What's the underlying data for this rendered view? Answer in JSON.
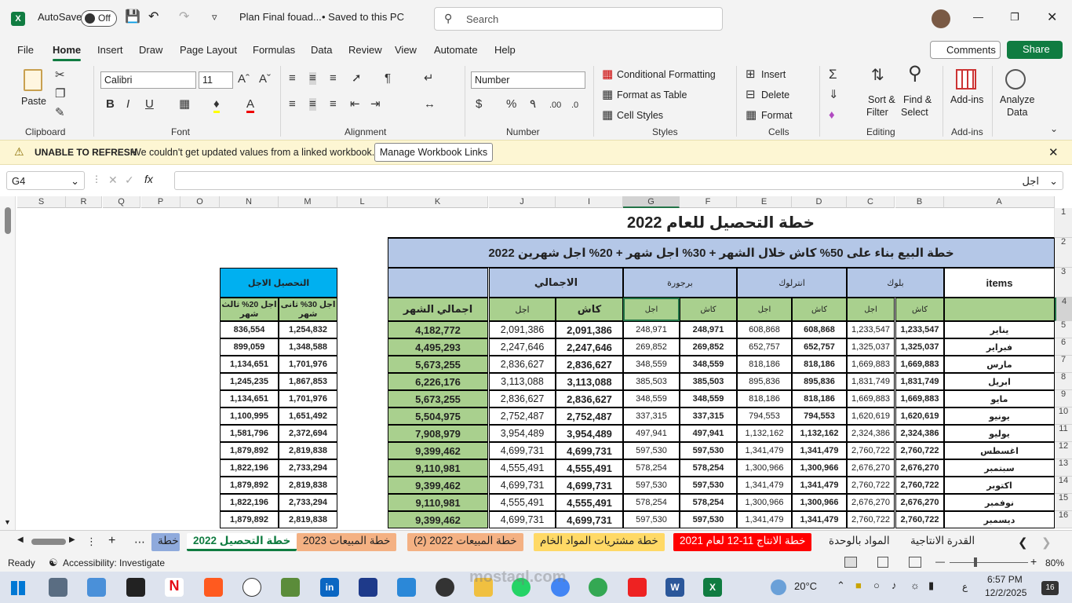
{
  "titlebar": {
    "autosave_label": "AutoSave",
    "autosave_state": "Off",
    "filename": "Plan Final fouad...",
    "save_status": "•  Saved to this PC",
    "search_placeholder": "Search"
  },
  "menu": [
    "File",
    "Home",
    "Insert",
    "Draw",
    "Page Layout",
    "Formulas",
    "Data",
    "Review",
    "View",
    "Automate",
    "Help"
  ],
  "menu_right": {
    "comments": "Comments",
    "share": "Share"
  },
  "ribbon": {
    "paste": "Paste",
    "font_name": "Calibri",
    "font_size": "11",
    "number_format": "Number",
    "conditional_formatting": "Conditional Formatting",
    "format_as_table": "Format as Table",
    "cell_styles": "Cell Styles",
    "insert": "Insert",
    "delete": "Delete",
    "format": "Format",
    "sort_filter_1": "Sort &",
    "sort_filter_2": "Filter",
    "find_select_1": "Find &",
    "find_select_2": "Select",
    "addins": "Add-ins",
    "analyze_1": "Analyze",
    "analyze_2": "Data",
    "groups": {
      "clipboard": "Clipboard",
      "font": "Font",
      "alignment": "Alignment",
      "number": "Number",
      "styles": "Styles",
      "cells": "Cells",
      "editing": "Editing",
      "addins": "Add-ins"
    }
  },
  "message": {
    "title": "UNABLE TO REFRESH",
    "text": "We couldn't get updated values from a linked workbook.",
    "button": "Manage Workbook Links"
  },
  "formula_bar": {
    "name_box": "G4",
    "content": "اجل",
    "fx": "fx"
  },
  "columns": [
    "S",
    "R",
    "Q",
    "P",
    "O",
    "N",
    "M",
    "L",
    "K",
    "J",
    "I",
    "G",
    "F",
    "E",
    "D",
    "C",
    "B",
    "A"
  ],
  "rows": [
    "1",
    "2",
    "3",
    "4",
    "5",
    "6",
    "7",
    "8",
    "9",
    "10",
    "11",
    "12",
    "13",
    "14",
    "15",
    "16"
  ],
  "sheet": {
    "title": "خطة التحصيل للعام 2022",
    "subtitle": "خطة البيع بناء على 50% كاش خلال الشهر + 30% اجل شهر + 20% اجل شهرين 2022",
    "deferred_header": "التحصيل الاجل",
    "n_header": "اجل 20% ثالث شهر",
    "m_header": "اجل 30% ثانى شهر",
    "total_month": "اجمالي الشهر",
    "total_header": "الاجمالي",
    "cash": "كاش",
    "deferred": "اجل",
    "items": "items",
    "groups": [
      "برجورة",
      "انترلوك",
      "بلوك"
    ],
    "months": [
      "يناير",
      "فبراير",
      "مارس",
      "ابريل",
      "مايو",
      "يونيو",
      "يوليو",
      "اغسطس",
      "سبتمبر",
      "اكتوبر",
      "نوفمبر",
      "ديسمبر"
    ],
    "rows": [
      [
        "836,554",
        "1,254,832",
        "4,182,772",
        "2,091,386",
        "2,091,386",
        "248,971",
        "248,971",
        "608,868",
        "608,868",
        "1,233,547",
        "1,233,547"
      ],
      [
        "899,059",
        "1,348,588",
        "4,495,293",
        "2,247,646",
        "2,247,646",
        "269,852",
        "269,852",
        "652,757",
        "652,757",
        "1,325,037",
        "1,325,037"
      ],
      [
        "1,134,651",
        "1,701,976",
        "5,673,255",
        "2,836,627",
        "2,836,627",
        "348,559",
        "348,559",
        "818,186",
        "818,186",
        "1,669,883",
        "1,669,883"
      ],
      [
        "1,245,235",
        "1,867,853",
        "6,226,176",
        "3,113,088",
        "3,113,088",
        "385,503",
        "385,503",
        "895,836",
        "895,836",
        "1,831,749",
        "1,831,749"
      ],
      [
        "1,134,651",
        "1,701,976",
        "5,673,255",
        "2,836,627",
        "2,836,627",
        "348,559",
        "348,559",
        "818,186",
        "818,186",
        "1,669,883",
        "1,669,883"
      ],
      [
        "1,100,995",
        "1,651,492",
        "5,504,975",
        "2,752,487",
        "2,752,487",
        "337,315",
        "337,315",
        "794,553",
        "794,553",
        "1,620,619",
        "1,620,619"
      ],
      [
        "1,581,796",
        "2,372,694",
        "7,908,979",
        "3,954,489",
        "3,954,489",
        "497,941",
        "497,941",
        "1,132,162",
        "1,132,162",
        "2,324,386",
        "2,324,386"
      ],
      [
        "1,879,892",
        "2,819,838",
        "9,399,462",
        "4,699,731",
        "4,699,731",
        "597,530",
        "597,530",
        "1,341,479",
        "1,341,479",
        "2,760,722",
        "2,760,722"
      ],
      [
        "1,822,196",
        "2,733,294",
        "9,110,981",
        "4,555,491",
        "4,555,491",
        "578,254",
        "578,254",
        "1,300,966",
        "1,300,966",
        "2,676,270",
        "2,676,270"
      ],
      [
        "1,879,892",
        "2,819,838",
        "9,399,462",
        "4,699,731",
        "4,699,731",
        "597,530",
        "597,530",
        "1,341,479",
        "1,341,479",
        "2,760,722",
        "2,760,722"
      ],
      [
        "1,822,196",
        "2,733,294",
        "9,110,981",
        "4,555,491",
        "4,555,491",
        "578,254",
        "578,254",
        "1,300,966",
        "1,300,966",
        "2,676,270",
        "2,676,270"
      ],
      [
        "1,879,892",
        "2,819,838",
        "9,399,462",
        "4,699,731",
        "4,699,731",
        "597,530",
        "597,530",
        "1,341,479",
        "1,341,479",
        "2,760,722",
        "2,760,722"
      ]
    ]
  },
  "tabs": [
    {
      "label": "خطة",
      "color": "#8faadc"
    },
    {
      "label": "خطة التحصيل 2022",
      "color": "active"
    },
    {
      "label": "خطة المبيعات 2023",
      "color": "#f4b183"
    },
    {
      "label": "خطة المبيعات 2022 (2)",
      "color": "#f4b183"
    },
    {
      "label": "خطة مشتريات المواد الخام",
      "color": "#ffd966"
    },
    {
      "label": "خطة الانتاج  11-12 لعام 2021",
      "color": "#ff0000"
    },
    {
      "label": "المواد بالوحدة",
      "color": "none"
    },
    {
      "label": "القدرة الانتاجية",
      "color": "none"
    }
  ],
  "status": {
    "ready": "Ready",
    "accessibility": "Accessibility: Investigate",
    "zoom": "80%"
  },
  "taskbar": {
    "temp": "20°C",
    "time": "6:57 PM",
    "date": "12/2/2025",
    "lang": "ع",
    "badge": "16"
  },
  "watermark": "mostaql.com",
  "colors": {
    "excel_green": "#107c41",
    "header_blue": "#b4c7e7",
    "col_green": "#a9d08e",
    "deferred_blue": "#00b0f0",
    "selection": "#217346"
  }
}
